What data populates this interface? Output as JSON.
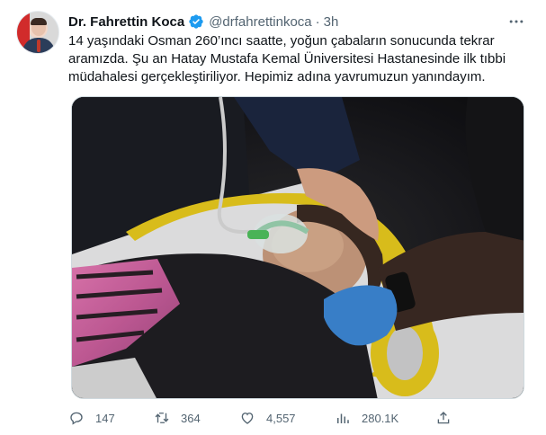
{
  "tweet": {
    "author_name": "Dr. Fahrettin Koca",
    "handle": "@drfahrettinkoca",
    "separator": "·",
    "time": "3h",
    "text_lines": [
      "14 yaşındaki Osman 260’ıncı saatte, yoğun çabaların sonucunda tekrar",
      "aramızda. Şu an Hatay Mustafa Kemal Üniversitesi Hastanesinde ilk tıbbi",
      "müdahalesi gerçekleştiriliyor. Hepimiz adına yavrumuzun yanındayım."
    ]
  },
  "actions": {
    "replies": "147",
    "retweets": "364",
    "likes": "4,557",
    "views": "280.1K"
  },
  "colors": {
    "verified": "#1d9bf0",
    "secondary_text": "#536471"
  },
  "icons": {
    "verified": "verified-badge-icon",
    "more": "more-icon",
    "reply": "reply-icon",
    "retweet": "retweet-icon",
    "like": "like-icon",
    "views": "views-icon",
    "share": "share-icon"
  }
}
